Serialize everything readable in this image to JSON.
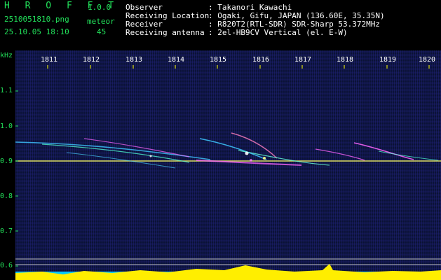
{
  "app": {
    "logo": "H R O F F T",
    "version": "1.0.0",
    "filename": "2510051810.png",
    "datetime": "25.10.05 18:10",
    "meteor_label": "meteor",
    "meteor_count": "45"
  },
  "info": {
    "observer_label": "Observer",
    "observer_value": ": Takanori Kawachi",
    "location_label": "Receiving Location",
    "location_value": ": Ogaki, Gifu, JAPAN (136.60E, 35.35N)",
    "receiver_label": "Receiver",
    "receiver_value": ": R820T2(RTL-SDR) SDR-Sharp 53.372MHz",
    "antenna_label": "Receiving antenna",
    "antenna_value": ": 2el-HB9CV Vertical (el. E-W)"
  },
  "axes": {
    "y_unit": "kHz",
    "y_ticks": [
      "1.1",
      "1.0",
      "0.9",
      "0.8",
      "0.7",
      "0.6"
    ],
    "x_ticks": [
      "1811",
      "1812",
      "1813",
      "1814",
      "1815",
      "1816",
      "1817",
      "1818",
      "1819",
      "1820"
    ]
  },
  "colors": {
    "accent_green": "#22e05a",
    "background": "#000000",
    "plot_bg": "#0a1234",
    "carrier_line": "#ffff66",
    "tick_yellow": "#ffff00",
    "bar_yellow": "#ffee00",
    "bar_cyan": "#00c8ff"
  }
}
